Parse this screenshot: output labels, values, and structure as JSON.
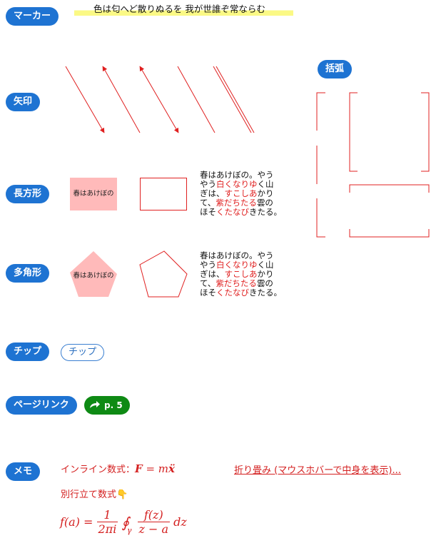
{
  "labels": {
    "marker": "マーカー",
    "arrow": "矢印",
    "rect": "長方形",
    "polygon": "多角形",
    "chip": "チップ",
    "pagelink": "ページリンク",
    "memo": "メモ",
    "bracket": "括弧"
  },
  "marker": {
    "text": "色は匂へど散りぬるを 我が世誰ぞ常ならむ"
  },
  "rect": {
    "fill_text": "春はあけぼの"
  },
  "polygon": {
    "fill_text": "春はあけぼの"
  },
  "paragraph": {
    "line1": "春はあけぼの。やう",
    "line2a": "やう",
    "line2b": "白くなりゆ",
    "line2c": "く山",
    "line3a": "ぎは、",
    "line3b": "すこしあ",
    "line3c": "かり",
    "line4a": "て、",
    "line4b": "紫だちたる",
    "line4c": "雲の",
    "line5a": "ほそ",
    "line5b": "くたなび",
    "line5c": "きたる。"
  },
  "chip": {
    "label": "チップ"
  },
  "pagelink": {
    "label": "p. 5"
  },
  "memo": {
    "inline_label": "インライン数式：",
    "inline_math_F": "F",
    "inline_math_eq": " = ",
    "inline_math_m": "m",
    "inline_math_x": "ẍ",
    "fold_text": "折り畳み (マウスホバーで中身を表示)...",
    "block_label": "別行立て数式",
    "point_icon": "👇",
    "f_a": "f(a) =",
    "one": "1",
    "two_pi_i": "2πi",
    "oint": "∮",
    "gamma": "γ",
    "f_z": "f(z)",
    "z_minus_a": "z − a",
    "dz": "dz"
  },
  "colors": {
    "pill_blue": "#1e73d2",
    "marker_yellow": "#fbf985",
    "annotation_red": "#e02020",
    "rect_pink": "#ffbaba",
    "pagelink_green": "#0e8a14"
  },
  "icons": {
    "pagelink_icon": "share-arrow-icon"
  }
}
